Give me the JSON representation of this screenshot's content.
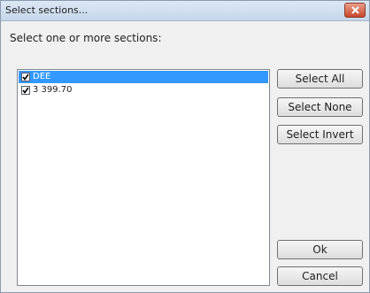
{
  "window": {
    "title": "Select sections..."
  },
  "prompt": "Select one or more sections:",
  "sections": [
    {
      "label": "DEE",
      "checked": true,
      "selected": true
    },
    {
      "label": "3 399.70",
      "checked": true,
      "selected": false
    }
  ],
  "buttons": {
    "select_all": "Select All",
    "select_none": "Select None",
    "select_invert": "Select Invert",
    "ok": "Ok",
    "cancel": "Cancel"
  },
  "colors": {
    "selection": "#3399ff",
    "close_button": "#c9462c"
  },
  "icons": {
    "close": "close-icon",
    "check": "checkmark-icon"
  }
}
